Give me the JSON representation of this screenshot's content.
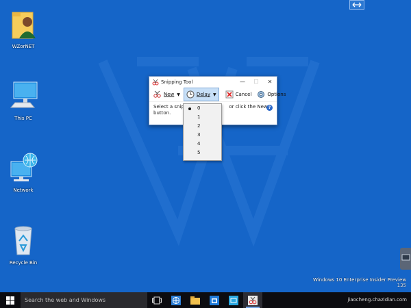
{
  "desktop": {
    "icons": [
      {
        "label": "WZorNET",
        "icon": "user-folder-icon"
      },
      {
        "label": "This PC",
        "icon": "computer-icon"
      },
      {
        "label": "Network",
        "icon": "network-icon"
      },
      {
        "label": "Recycle Bin",
        "icon": "recycle-bin-icon"
      }
    ],
    "watermark_line1": "Windows 10 Enterprise Insider Preview",
    "watermark_line2": "135",
    "colors": {
      "background": "#1565c8"
    }
  },
  "snipping_tool": {
    "title": "Snipping Tool",
    "controls": {
      "minimize": "—",
      "maximize": "☐",
      "close": "✕"
    },
    "toolbar": {
      "new_label": "New",
      "delay_label": "Delay",
      "cancel_label": "Cancel",
      "options_label": "Options"
    },
    "body_text_left": "Select a snip ty",
    "body_text_right": "or click the New",
    "body_text_line2": "button.",
    "help": "?"
  },
  "delay_menu": {
    "options": [
      "0",
      "1",
      "2",
      "3",
      "4",
      "5"
    ],
    "selected": "0"
  },
  "taskbar": {
    "search_placeholder": "Search the web and Windows",
    "tray_text": "jiaocheng.chazidian.com"
  }
}
